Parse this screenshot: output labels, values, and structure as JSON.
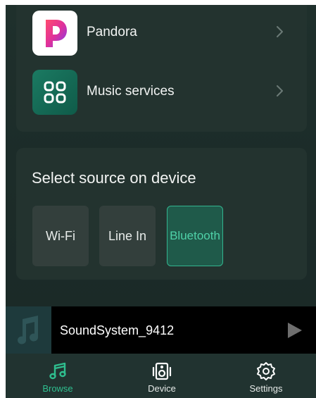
{
  "services": [
    {
      "label": "Pandora",
      "icon": "pandora-logo-icon"
    },
    {
      "label": "Music services",
      "icon": "grid-services-icon"
    }
  ],
  "source": {
    "title": "Select source on device",
    "options": [
      "Wi-Fi",
      "Line In",
      "Bluetooth"
    ],
    "selected": "Bluetooth"
  },
  "player": {
    "track": "SoundSystem_9412",
    "icons": [
      "music-note-icon",
      "play-icon"
    ]
  },
  "tabs": [
    {
      "label": "Browse",
      "icon": "music-note-icon",
      "active": true
    },
    {
      "label": "Device",
      "icon": "speaker-icon",
      "active": false
    },
    {
      "label": "Settings",
      "icon": "gear-icon",
      "active": false
    }
  ],
  "colors": {
    "accent": "#2fbf8f",
    "background": "#1d2d2a",
    "card": "#23332f"
  }
}
